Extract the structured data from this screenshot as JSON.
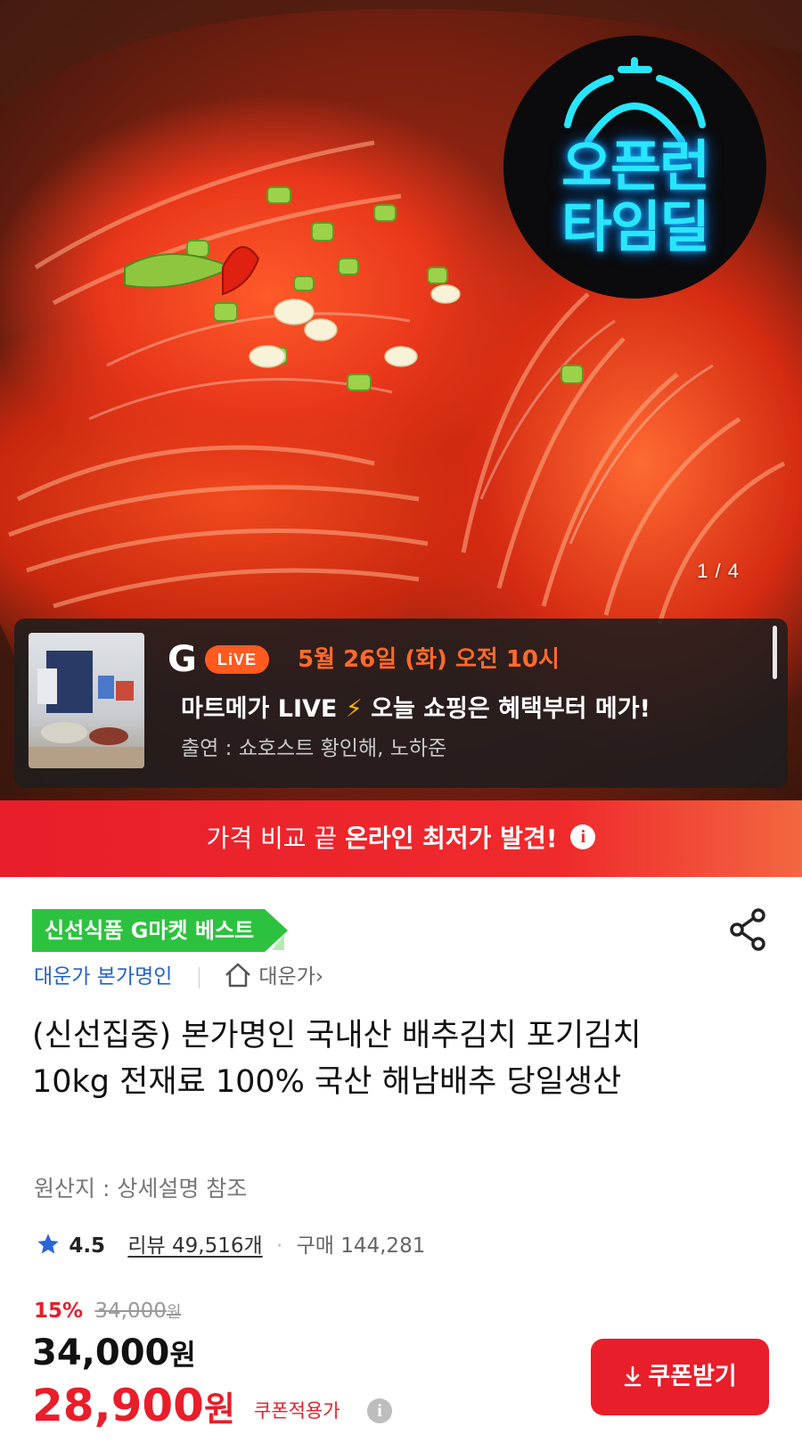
{
  "hero": {
    "deal_badge_line1": "오픈런",
    "deal_badge_line2": "타임딜",
    "pager": "1 / 4"
  },
  "live": {
    "logo": "G",
    "pill": "LiVE",
    "date": "5월 26일 (화) 오전 10시",
    "title_part1": "마트메가 LIVE",
    "title_bolt": "⚡",
    "title_part2": " 오늘 쇼핑은 혜택부터 메가!",
    "cast": "출연 : 쇼호스트 황인해, 노하준"
  },
  "price_bar": {
    "prefix": "가격 비교 끝 ",
    "highlight": "온라인 최저가 발견!",
    "info": "i"
  },
  "product": {
    "badge": "신선식품 G마켓 베스트",
    "seller": "대운가 본가명인",
    "store_link": "대운가",
    "store_chevron": "›",
    "title": "(신선집중) 본가명인 국내산 배추김치 포기김치 10kg 전재료 100% 국산 해남배추 당일생산",
    "origin": "원산지 : 상세설명 참조",
    "rating": "4.5",
    "reviews": "리뷰 49,516개",
    "dot": "·",
    "purchases": "구매 144,281"
  },
  "pricing": {
    "discount_rate": "15%",
    "original_price": "34,000",
    "original_unit": "원",
    "sale_price": "34,000",
    "sale_unit": "원",
    "coupon_price": "28,900",
    "coupon_unit": "원",
    "coupon_label": "쿠폰적용가",
    "coupon_info": "i",
    "coupon_button": "쿠폰받기"
  },
  "colors": {
    "accent_red": "#e81e2a",
    "best_green": "#2cc23f",
    "seller_blue": "#2563c9",
    "live_orange": "#ff5a1f",
    "neon_cyan": "#29e6ff"
  },
  "icons": [
    "alarm-clock-icon",
    "info-icon",
    "share-icon",
    "home-icon",
    "star-icon",
    "download-icon",
    "scroll-indicator"
  ]
}
